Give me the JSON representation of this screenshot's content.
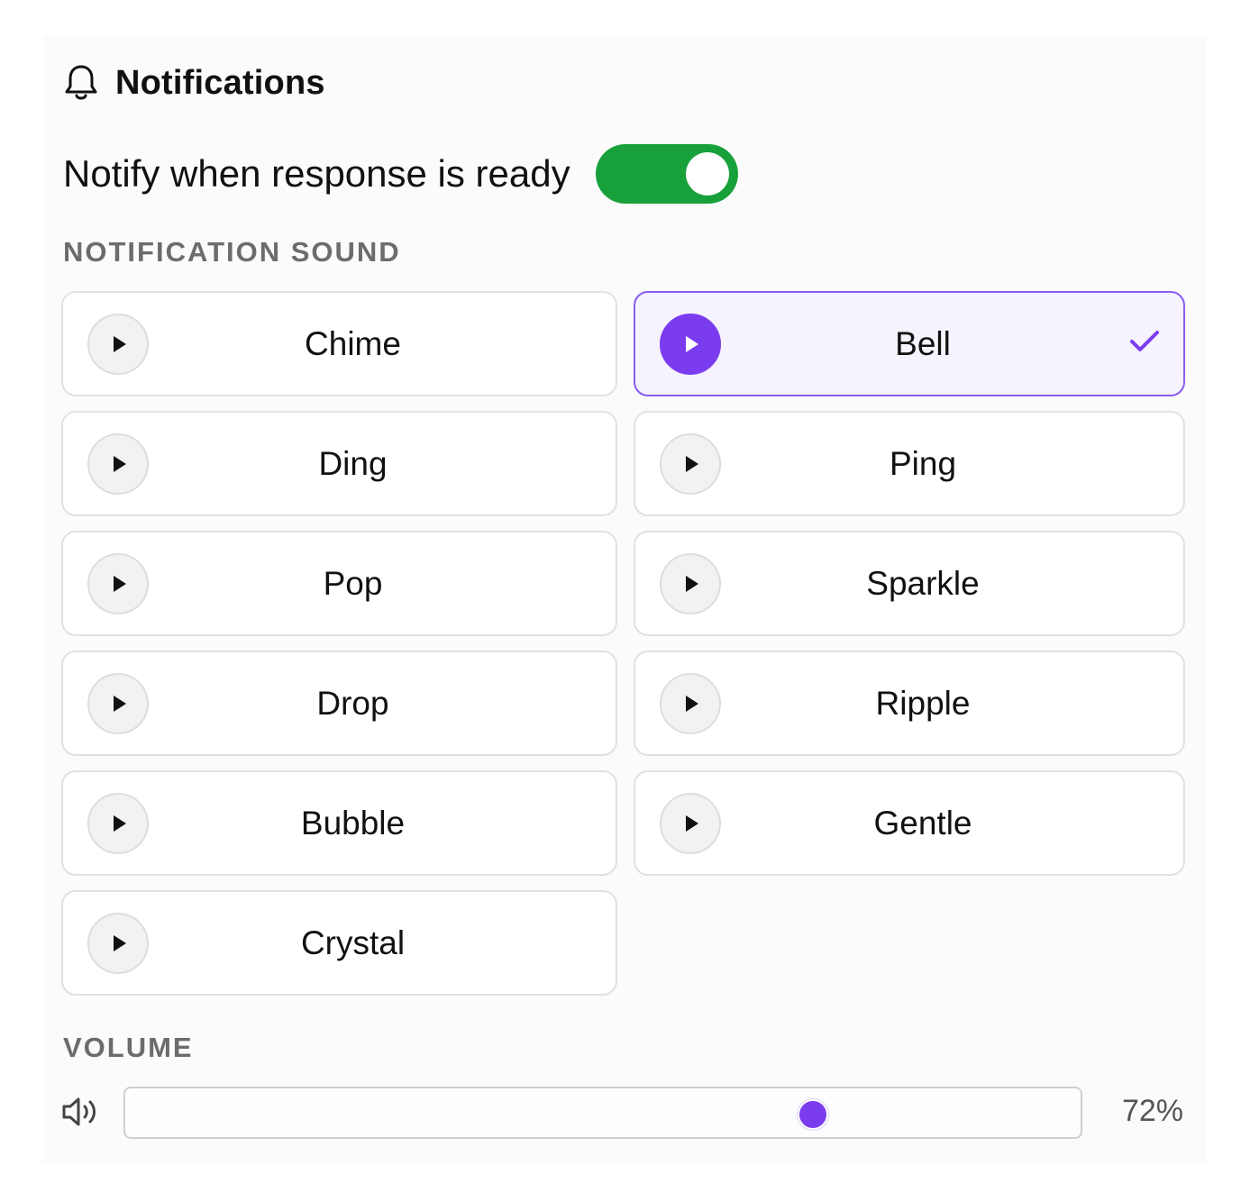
{
  "header": {
    "title": "Notifications",
    "icon": "bell-icon"
  },
  "notify": {
    "label": "Notify when response is ready",
    "enabled": true,
    "toggle_color": "#18a03a"
  },
  "sound_section": {
    "label": "NOTIFICATION SOUND",
    "selected": "Bell",
    "accent_color": "#7b3cf0",
    "options": [
      {
        "name": "Chime",
        "selected": false
      },
      {
        "name": "Bell",
        "selected": true
      },
      {
        "name": "Ding",
        "selected": false
      },
      {
        "name": "Ping",
        "selected": false
      },
      {
        "name": "Pop",
        "selected": false
      },
      {
        "name": "Sparkle",
        "selected": false
      },
      {
        "name": "Drop",
        "selected": false
      },
      {
        "name": "Ripple",
        "selected": false
      },
      {
        "name": "Bubble",
        "selected": false
      },
      {
        "name": "Gentle",
        "selected": false
      },
      {
        "name": "Crystal",
        "selected": false
      }
    ]
  },
  "volume": {
    "label": "VOLUME",
    "value_text": "72%",
    "value": 0.72,
    "icon": "speaker-icon"
  }
}
